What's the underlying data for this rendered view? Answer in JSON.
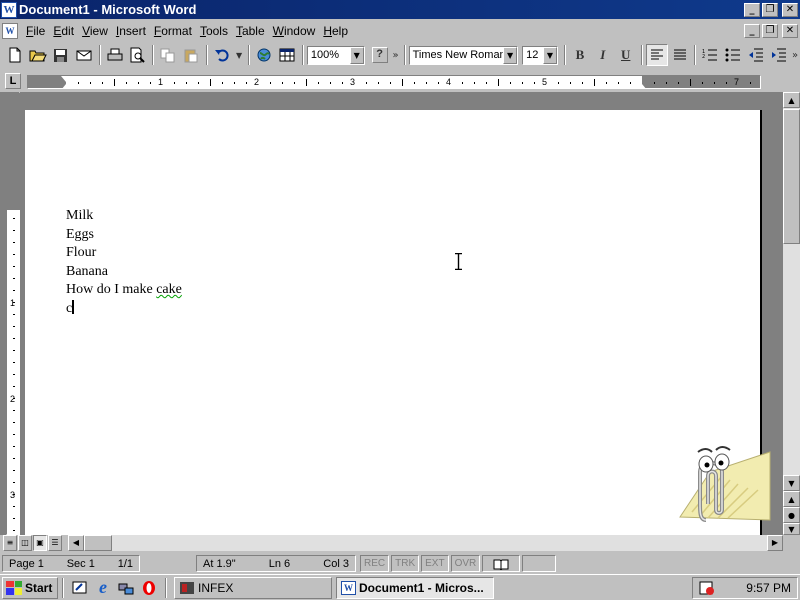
{
  "window": {
    "title": "Document1 - Microsoft Word",
    "app_icon": "W",
    "buttons": [
      "_",
      "❐",
      "✕"
    ]
  },
  "menubar": {
    "doc_icon": "W",
    "items": [
      "File",
      "Edit",
      "View",
      "Insert",
      "Format",
      "Tools",
      "Table",
      "Window",
      "Help"
    ]
  },
  "toolbar": {
    "zoom": "100%",
    "help": "?",
    "font_name": "Times New Roman",
    "font_size": "12",
    "bold": "B",
    "italic": "I",
    "underline": "U",
    "more": "»"
  },
  "ruler": {
    "tab_selector": "L",
    "numbers": [
      "1",
      "2",
      "3",
      "4",
      "5",
      "7"
    ],
    "v_numbers": [
      "1",
      "2",
      "3"
    ]
  },
  "document": {
    "lines": [
      "Milk",
      "Eggs",
      "Flour",
      "Banana",
      "How do I make ",
      "cake",
      "c"
    ]
  },
  "statusbar": {
    "page": "Page 1",
    "sec": "Sec 1",
    "pages": "1/1",
    "at": "At 1.9\"",
    "ln": "Ln 6",
    "col": "Col 3",
    "rec": "REC",
    "trk": "TRK",
    "ext": "EXT",
    "ovr": "OVR"
  },
  "taskbar": {
    "start": "Start",
    "tasks": [
      "INFEX",
      "Document1 - Micros..."
    ],
    "clock": "9:57 PM"
  },
  "colors": {
    "titlebar": "#0a246a",
    "chrome": "#c0c0c0",
    "workspace": "#808080",
    "spell_squiggle": "#00a000"
  }
}
